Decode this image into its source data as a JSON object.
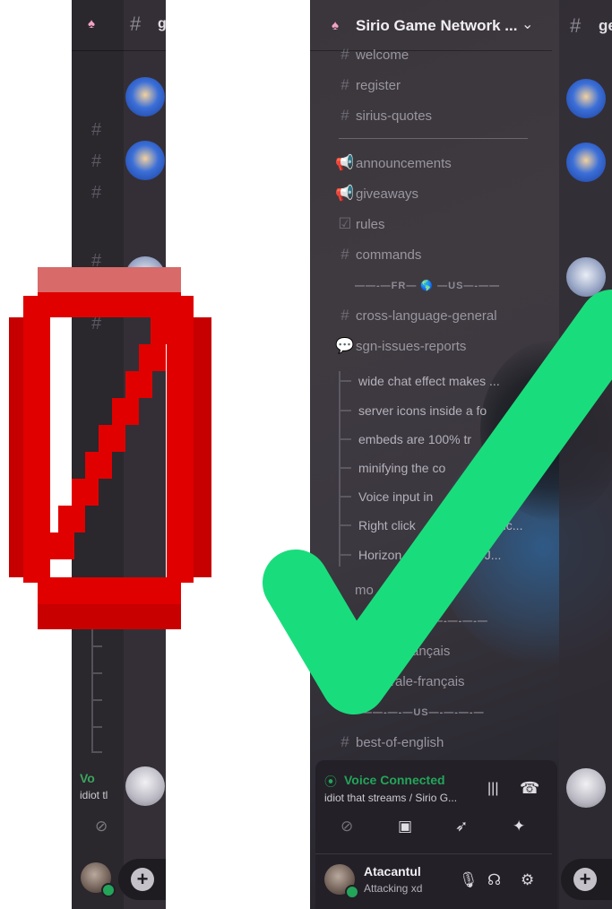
{
  "left_panel": {
    "header_partial": "g",
    "voice_partial": "Vo",
    "voice_sub_partial": "idiot tl"
  },
  "right_panel": {
    "server_name": "Sirio Game Network ...",
    "header_partial": "ge",
    "channels": [
      {
        "icon": "#",
        "label": "welcome"
      },
      {
        "icon": "#",
        "label": "register"
      },
      {
        "icon": "#",
        "label": "sirius-quotes"
      },
      {
        "icon": "📢",
        "label": "announcements"
      },
      {
        "icon": "📢",
        "label": "giveaways"
      },
      {
        "icon": "☑",
        "label": "rules"
      },
      {
        "icon": "#",
        "label": "commands"
      }
    ],
    "divider_fr_us": "——-—FR— 🌎 —US—-——",
    "channels2": [
      {
        "icon": "#",
        "label": "cross-language-general"
      },
      {
        "icon": "💬",
        "label": "sgn-issues-reports"
      }
    ],
    "threads": [
      "wide chat effect makes ...",
      "server icons inside a fo",
      "embeds are 100% tr",
      "minifying the co",
      "Voice input in",
      "Right click",
      "Horizon"
    ],
    "thread_tails": [
      "",
      "",
      "",
      "",
      ".",
      "nc...",
      "st is J..."
    ],
    "lower_channels": [
      {
        "icon": "",
        "label": "mo",
        "tail": "ws"
      },
      {
        "icon": "",
        "label": "",
        "tail": "rançais"
      },
      {
        "icon": "",
        "label": "",
        "tail": "rale-français"
      }
    ],
    "divider_fr": "R—-—-—-—",
    "divider_us": "——-—-—US—-—-—-—",
    "best_of": {
      "icon": "#",
      "label": "best-of-english"
    },
    "voice": {
      "title": "Voice Connected",
      "subtitle": "idiot that streams / Sirio G..."
    },
    "user": {
      "name": "Atacantul",
      "status": "Attacking xd"
    }
  },
  "colors": {
    "red_mark": "#e00000",
    "green_check": "#19dd7c",
    "voice_green": "#23a55a"
  }
}
